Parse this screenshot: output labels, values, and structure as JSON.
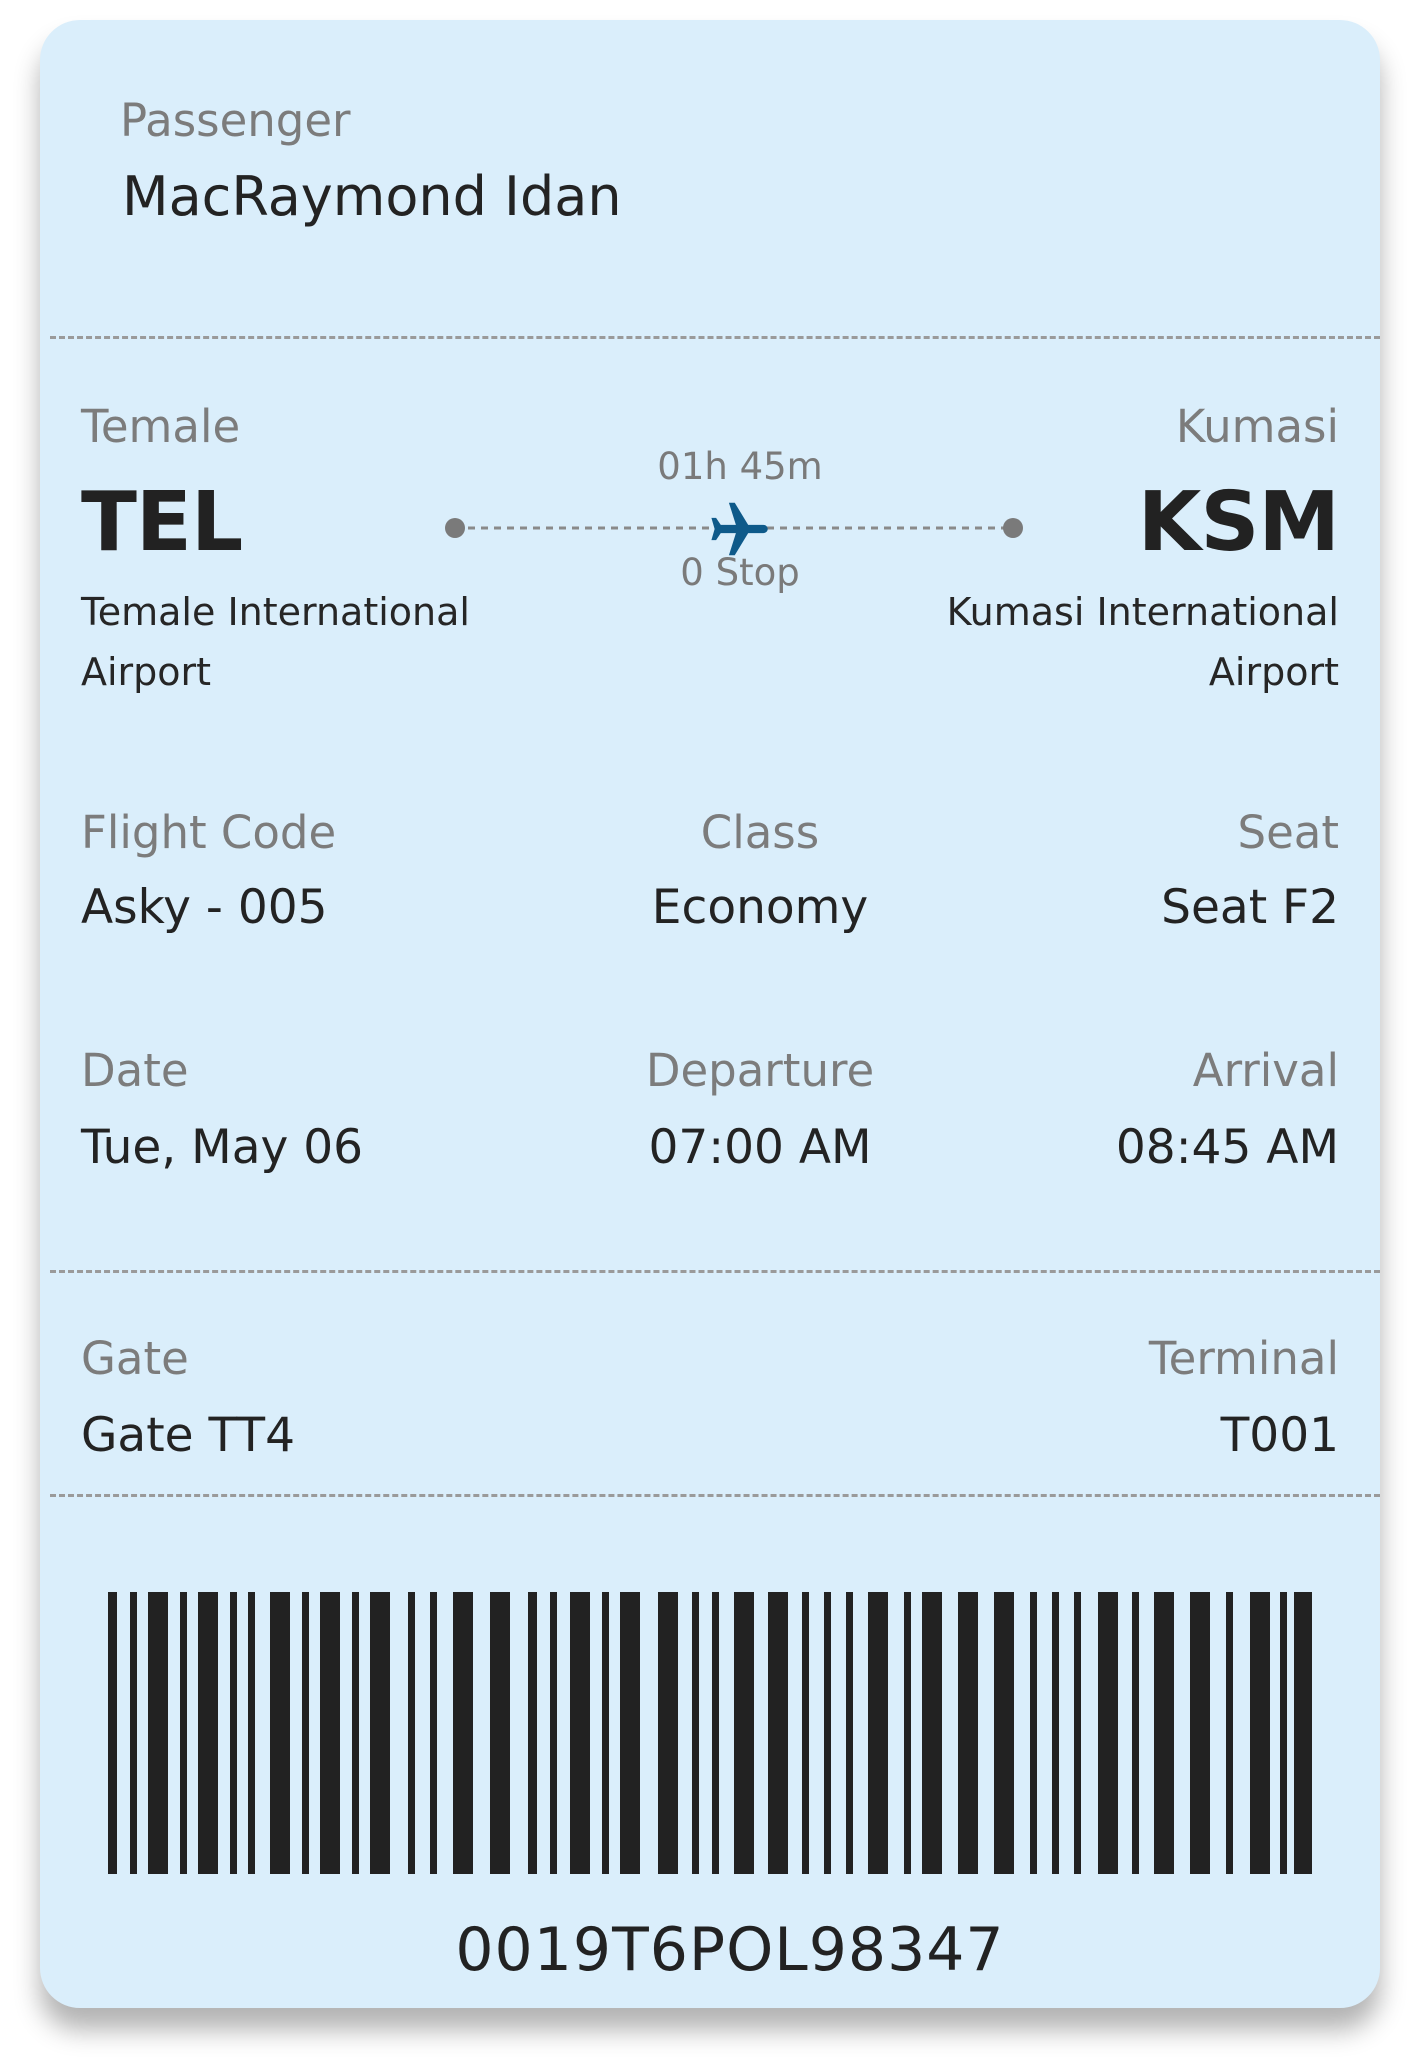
{
  "passenger": {
    "label": "Passenger",
    "name": "MacRaymond Idan"
  },
  "route": {
    "origin": {
      "city": "Temale",
      "code": "TEL",
      "airport": "Temale International Airport"
    },
    "destination": {
      "city": "Kumasi",
      "code": "KSM",
      "airport": "Kumasi International Airport"
    },
    "duration": "01h 45m",
    "stops": "0 Stop",
    "plane_icon": "airplane-icon",
    "plane_color": "#0e5a8a"
  },
  "flight_code": {
    "label": "Flight Code",
    "value": "Asky - 005"
  },
  "class": {
    "label": "Class",
    "value": "Economy"
  },
  "seat": {
    "label": "Seat",
    "value": "Seat F2"
  },
  "date": {
    "label": "Date",
    "value": "Tue, May 06"
  },
  "departure": {
    "label": "Departure",
    "value": "07:00 AM"
  },
  "arrival": {
    "label": "Arrival",
    "value": "08:45 AM"
  },
  "gate": {
    "label": "Gate",
    "value": "Gate TT4"
  },
  "terminal": {
    "label": "Terminal",
    "value": "T001"
  },
  "barcode": {
    "number": "0019T6POL98347",
    "color": "#222222"
  },
  "colors": {
    "card_background": "#daeefb",
    "label_text": "#7c7c7c",
    "value_text": "#232323"
  }
}
